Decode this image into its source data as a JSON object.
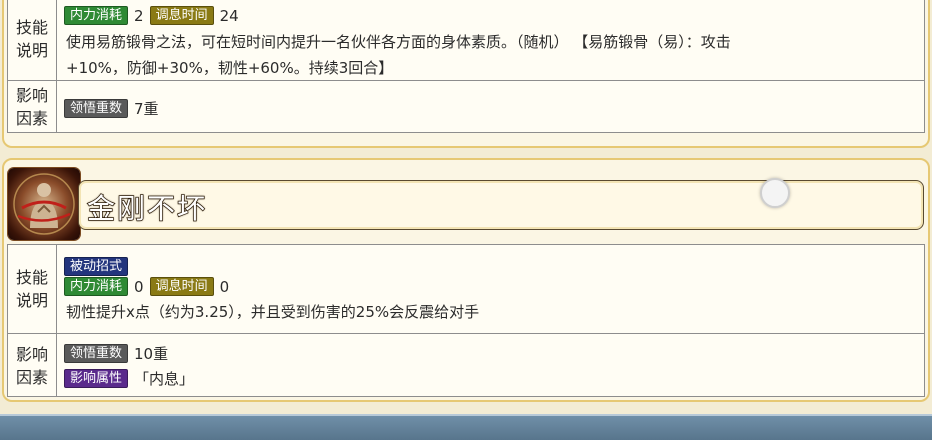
{
  "skill_prev": {
    "row1_label": "技能\n说明",
    "internal_cost_tag": "内力消耗",
    "internal_cost_value": "2",
    "cooldown_tag": "调息时间",
    "cooldown_value": "24",
    "desc_line1": "使用易筋锻骨之法，可在短时间内提升一名伙伴各方面的身体素质。（随机）  【易筋锻骨（易）：攻击",
    "desc_line2": "+10%，防御+30%，韧性+60%。持续3回合】",
    "row2_label": "影响\n因素",
    "comprehension_tag": "领悟重数",
    "comprehension_value": "7重"
  },
  "skill": {
    "title": "金刚不坏",
    "icon": "skill-portrait-icon",
    "row1_label": "技能\n说明",
    "passive_tag": "被动招式",
    "internal_cost_tag": "内力消耗",
    "internal_cost_value": "0",
    "cooldown_tag": "调息时间",
    "cooldown_value": "0",
    "desc_line1": "韧性提升x点（约为3.25），并且受到伤害的25%会反震给对手",
    "row2_label": "影响\n因素",
    "comprehension_tag": "领悟重数",
    "comprehension_value": "10重",
    "attribute_tag": "影响属性",
    "attribute_value": "「内息」"
  },
  "colors": {
    "card_border": "#e6c873",
    "tag_green": "#2f8a34",
    "tag_olive": "#8a7a14",
    "tag_gray": "#5a5a5a",
    "tag_navy": "#23357d",
    "tag_purple": "#5a2a8c"
  }
}
